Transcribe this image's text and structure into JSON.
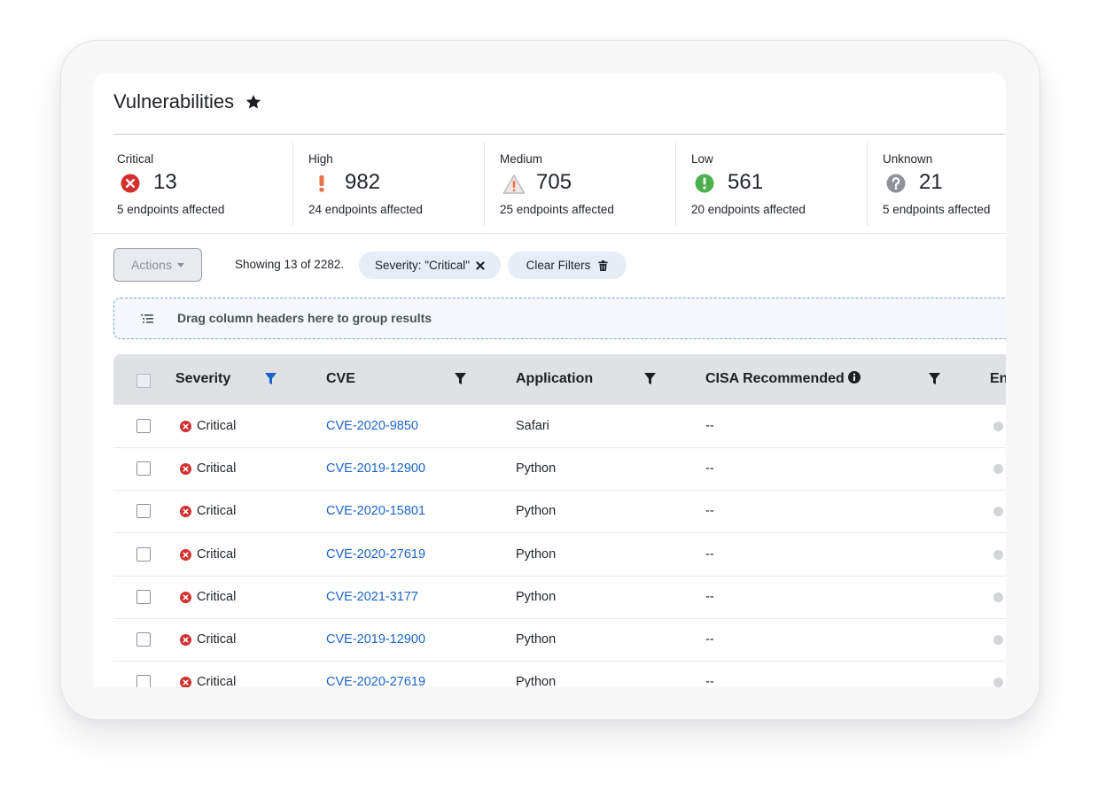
{
  "page": {
    "title": "Vulnerabilities"
  },
  "icons": {
    "favorite": "star-icon",
    "critical": "x-circle-icon",
    "high": "exclamation-icon",
    "medium": "warning-triangle-icon",
    "low": "exclamation-circle-icon",
    "unknown": "question-circle-icon",
    "group": "list-indent-icon",
    "filter": "funnel-icon",
    "info": "info-circle-icon",
    "remove": "x-icon",
    "clear": "trash-icon"
  },
  "colors": {
    "critical": "#d32f2f",
    "high": "#e8734a",
    "low": "#4caf50",
    "unknown": "#8e9198",
    "link": "#1a64c9",
    "active_filter": "#1a64c9"
  },
  "stats": [
    {
      "label": "Critical",
      "count": "13",
      "endpoints": "5 endpoints affected"
    },
    {
      "label": "High",
      "count": "982",
      "endpoints": "24 endpoints affected"
    },
    {
      "label": "Medium",
      "count": "705",
      "endpoints": "25 endpoints affected"
    },
    {
      "label": "Low",
      "count": "561",
      "endpoints": "20 endpoints affected"
    },
    {
      "label": "Unknown",
      "count": "21",
      "endpoints": "5 endpoints affected"
    }
  ],
  "toolbar": {
    "actions_label": "Actions",
    "showing_text": "Showing 13 of 2282.",
    "filter_chip_label": "Severity: \"Critical\"",
    "clear_filters_label": "Clear Filters"
  },
  "group_zone": {
    "text": "Drag column headers here to group results"
  },
  "table": {
    "columns": [
      "Severity",
      "CVE",
      "Application",
      "CISA Recommended",
      "En"
    ],
    "rows": [
      {
        "severity": "Critical",
        "cve": "CVE-2020-9850",
        "application": "Safari",
        "cisa": "--"
      },
      {
        "severity": "Critical",
        "cve": "CVE-2019-12900",
        "application": "Python",
        "cisa": "--"
      },
      {
        "severity": "Critical",
        "cve": "CVE-2020-15801",
        "application": "Python",
        "cisa": "--"
      },
      {
        "severity": "Critical",
        "cve": "CVE-2020-27619",
        "application": "Python",
        "cisa": "--"
      },
      {
        "severity": "Critical",
        "cve": "CVE-2021-3177",
        "application": "Python",
        "cisa": "--"
      },
      {
        "severity": "Critical",
        "cve": "CVE-2019-12900",
        "application": "Python",
        "cisa": "--"
      },
      {
        "severity": "Critical",
        "cve": "CVE-2020-27619",
        "application": "Python",
        "cisa": "--"
      }
    ]
  }
}
